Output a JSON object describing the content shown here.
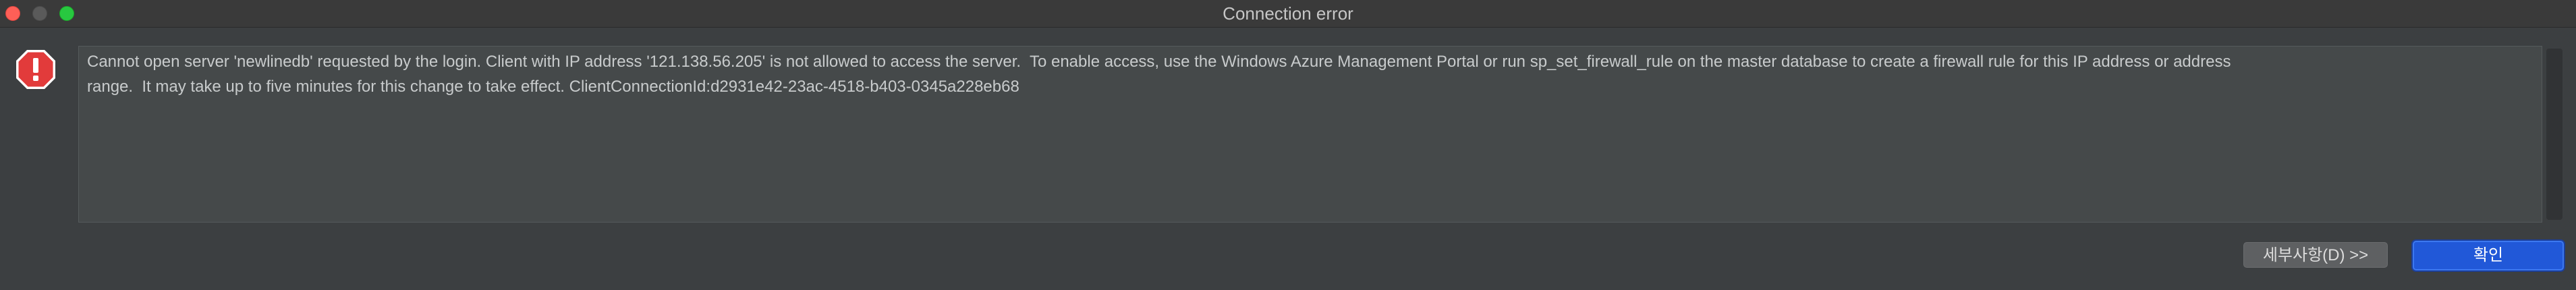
{
  "window": {
    "title": "Connection error"
  },
  "dialog": {
    "icon": "error-stop-icon",
    "message": "Cannot open server 'newlinedb' requested by the login. Client with IP address '121.138.56.205' is not allowed to access the server.  To enable access, use the Windows Azure Management Portal or run sp_set_firewall_rule on the master database to create a firewall rule for this IP address or address\nrange.  It may take up to five minutes for this change to take effect. ClientConnectionId:d2931e42-23ac-4518-b403-0345a228eb68"
  },
  "buttons": {
    "details_label": "세부사항(D) >>",
    "ok_label": "확인"
  },
  "colors": {
    "accent": "#2158d8",
    "error_red": "#e23b3b",
    "background": "#3c3f41"
  }
}
